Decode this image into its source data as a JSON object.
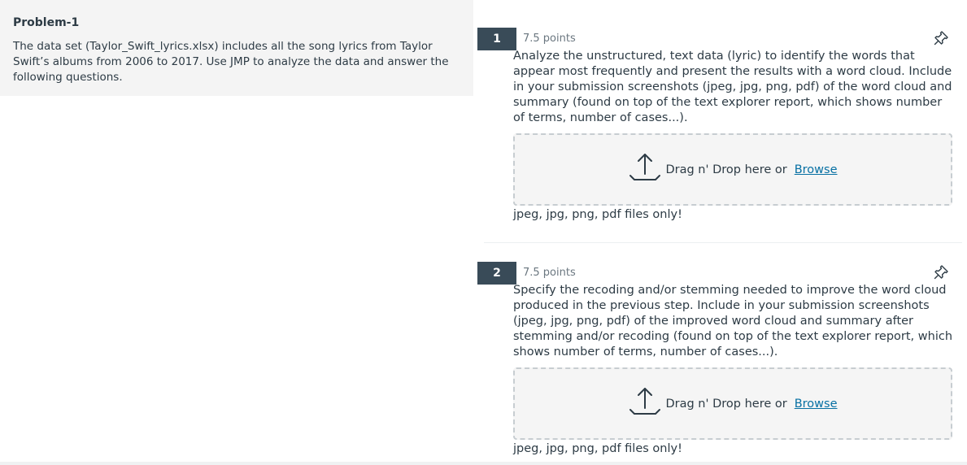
{
  "passage": {
    "title": "Problem-1",
    "text": "The data set (Taylor_Swift_lyrics.xlsx) includes all the song lyrics from Taylor Swift’s albums from 2006 to 2017. Use JMP to analyze the data and answer the following questions."
  },
  "questions": [
    {
      "number": "1",
      "points": "7.5 points",
      "text": "Analyze the unstructured, text data (lyric) to identify the words that appear most frequently and present the results with a word cloud. Include in your submission screenshots (jpeg, jpg, png, pdf) of the word cloud and summary (found on top of the text explorer report, which shows number of terms, number of cases...).",
      "drop_text": "Drag n' Drop here or",
      "browse_label": "Browse",
      "file_hint": "jpeg, jpg, png, pdf files only!"
    },
    {
      "number": "2",
      "points": "7.5 points",
      "text": "Specify the recoding and/or stemming needed to improve the word cloud produced in the previous step. Include in your submission screenshots (jpeg, jpg, png, pdf) of the improved word cloud and summary after stemming and/or recoding (found on top of the text explorer report, which shows number of terms, number of cases...).",
      "drop_text": "Drag n' Drop here or",
      "browse_label": "Browse",
      "file_hint": "jpeg, jpg, png, pdf files only!"
    }
  ],
  "icons": {
    "pin": "pin-icon",
    "upload": "upload-icon"
  },
  "colors": {
    "number_badge": "#394b58",
    "link": "#0770a3",
    "text": "#2d3b45",
    "panel_bg": "#f4f4f4"
  }
}
